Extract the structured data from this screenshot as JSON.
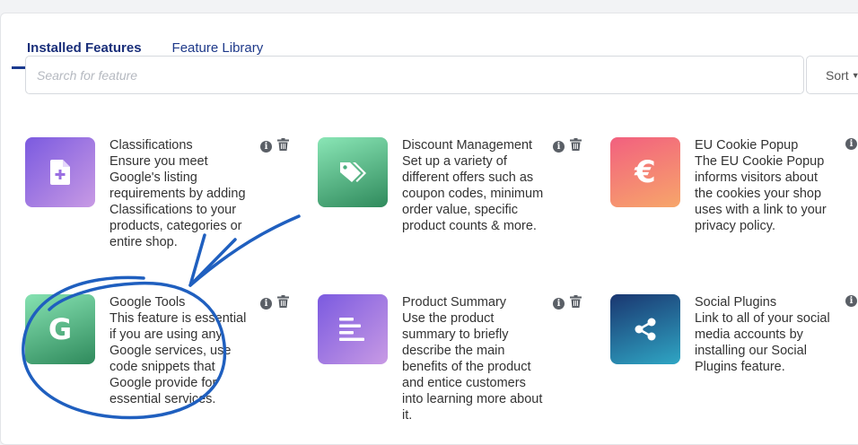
{
  "tabs": [
    {
      "label": "Installed Features",
      "active": true
    },
    {
      "label": "Feature Library",
      "active": false
    }
  ],
  "search": {
    "placeholder": "Search for feature"
  },
  "sort": {
    "label": "Sort"
  },
  "features": [
    {
      "name": "Classifications",
      "description": "Ensure you meet Google's listing requirements by adding Classifications to your products, categories or entire shop.",
      "icon": "file-plus-icon",
      "gradient": [
        "#7b5ae0",
        "#c28be0"
      ]
    },
    {
      "name": "Discount Management",
      "description": "Set up a variety of different offers such as coupon codes, minimum order value, specific product counts & more.",
      "icon": "tags-icon",
      "gradient": [
        "#82e0b0",
        "#2f8a5c"
      ]
    },
    {
      "name": "EU Cookie Popup",
      "description": "The EU Cookie Popup informs visitors about the cookies your shop uses with a link to your privacy policy.",
      "icon": "euro-icon",
      "gradient": [
        "#f26b8a",
        "#f59f6a"
      ]
    },
    {
      "name": "Google Tools",
      "description": "This feature is essential if you are using any Google services, use code snippets that Google provide for essential services.",
      "icon": "google-g-icon",
      "gradient": [
        "#7fdcaa",
        "#2f8a5c"
      ]
    },
    {
      "name": "Product Summary",
      "description": "Use the product summary to briefly describe the main benefits of the product and entice customers into learning more about it.",
      "icon": "align-left-icon",
      "gradient": [
        "#7b5ae0",
        "#c28be0"
      ]
    },
    {
      "name": "Social Plugins",
      "description": "Link to all of your social media accounts by installing our Social Plugins feature.",
      "icon": "share-icon",
      "gradient": [
        "#1d3f78",
        "#2ea3c2"
      ]
    }
  ],
  "colors": {
    "accent": "#1a3a8f",
    "annotation": "#1f5fbf"
  }
}
